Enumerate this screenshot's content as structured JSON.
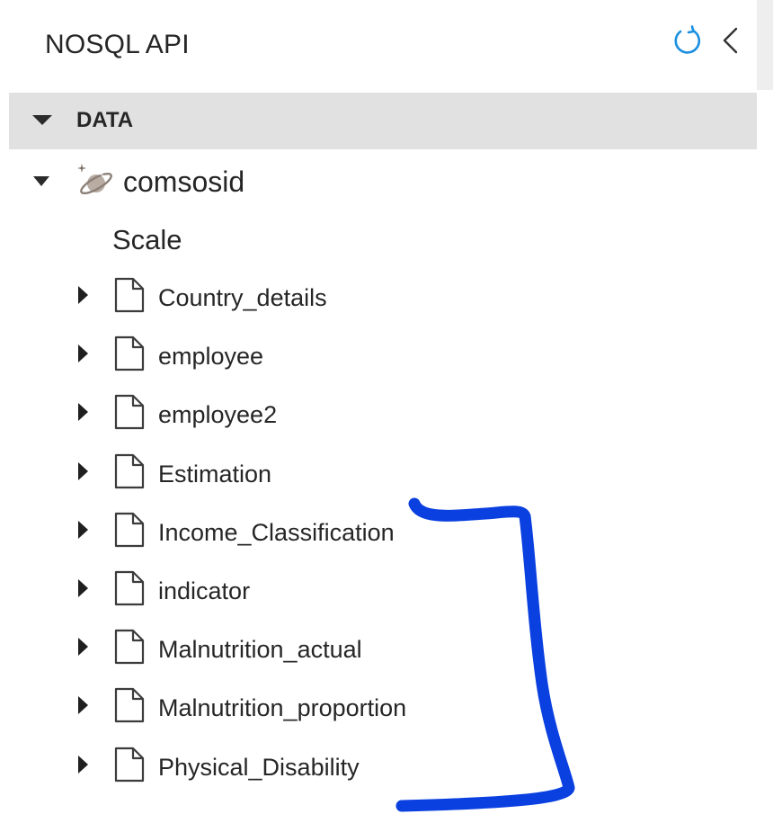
{
  "header": {
    "title": "NOSQL API",
    "refresh_icon": "refresh-icon",
    "collapse_icon": "chevron-left-icon"
  },
  "section": {
    "label": "DATA",
    "expanded": true
  },
  "database": {
    "name": "comsosid",
    "icon": "cosmos-database-icon",
    "expanded": true
  },
  "scale": {
    "label": "Scale"
  },
  "collections": [
    {
      "label": "Country_details"
    },
    {
      "label": "employee"
    },
    {
      "label": "employee2"
    },
    {
      "label": "Estimation"
    },
    {
      "label": "Income_Classification"
    },
    {
      "label": "indicator"
    },
    {
      "label": "Malnutrition_actual"
    },
    {
      "label": "Malnutrition_proportion"
    },
    {
      "label": "Physical_Disability"
    }
  ],
  "colors": {
    "accent_blue": "#1a8fe0",
    "annotation_stroke": "#0a3fe0",
    "section_header_bg": "#e1e1e1"
  }
}
